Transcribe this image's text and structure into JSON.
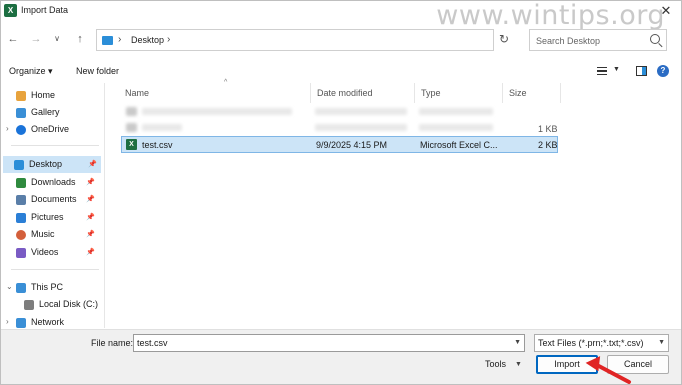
{
  "window": {
    "title": "Import Data",
    "app_icon": "X",
    "close_glyph": "✕"
  },
  "watermark": "www.wintips.org",
  "nav": {
    "address_location": "Desktop",
    "search_placeholder": "Search Desktop"
  },
  "commandbar": {
    "organize_label": "Organize ▾",
    "new_folder_label": "New folder"
  },
  "sidebar": {
    "items": [
      {
        "label": "Home",
        "icon": "home-icon",
        "color": "#e8a33d"
      },
      {
        "label": "Gallery",
        "icon": "gallery-icon",
        "color": "#3a8fd6"
      },
      {
        "label": "OneDrive",
        "icon": "onedrive-icon",
        "color": "#1a73d9"
      },
      {
        "label": "Desktop",
        "icon": "desktop-icon",
        "color": "#2b8ed8",
        "pinned": true,
        "selected": true
      },
      {
        "label": "Downloads",
        "icon": "downloads-icon",
        "color": "#2f8a3e",
        "pinned": true
      },
      {
        "label": "Documents",
        "icon": "documents-icon",
        "color": "#5a7ea8",
        "pinned": true
      },
      {
        "label": "Pictures",
        "icon": "pictures-icon",
        "color": "#2b7fd6",
        "pinned": true
      },
      {
        "label": "Music",
        "icon": "music-icon",
        "color": "#d35f3b",
        "pinned": true
      },
      {
        "label": "Videos",
        "icon": "videos-icon",
        "color": "#7a5bc4",
        "pinned": true
      },
      {
        "label": "This PC",
        "icon": "this-pc-icon",
        "color": "#3a8fd6"
      },
      {
        "label": "Local Disk (C:)",
        "icon": "local-disk-icon",
        "color": "#7d7d7d"
      },
      {
        "label": "Network",
        "icon": "network-icon",
        "color": "#3a8fd6"
      }
    ]
  },
  "columns": {
    "name": "Name",
    "date": "Date modified",
    "type": "Type",
    "size": "Size"
  },
  "files": [
    {
      "size": "1 KB"
    },
    {
      "name": "test.csv",
      "date": "9/9/2025 4:15 PM",
      "type": "Microsoft Excel C...",
      "size": "2 KB",
      "selected": true
    }
  ],
  "footer": {
    "file_name_label": "File name:",
    "file_name_value": "test.csv",
    "filter_value": "Text Files (*.prn;*.txt;*.csv)",
    "tools_label": "Tools",
    "import_label": "Import",
    "cancel_label": "Cancel"
  },
  "colors": {
    "accent": "#0067c0",
    "selection": "#cce4f7",
    "annotation_arrow": "#e02424"
  }
}
